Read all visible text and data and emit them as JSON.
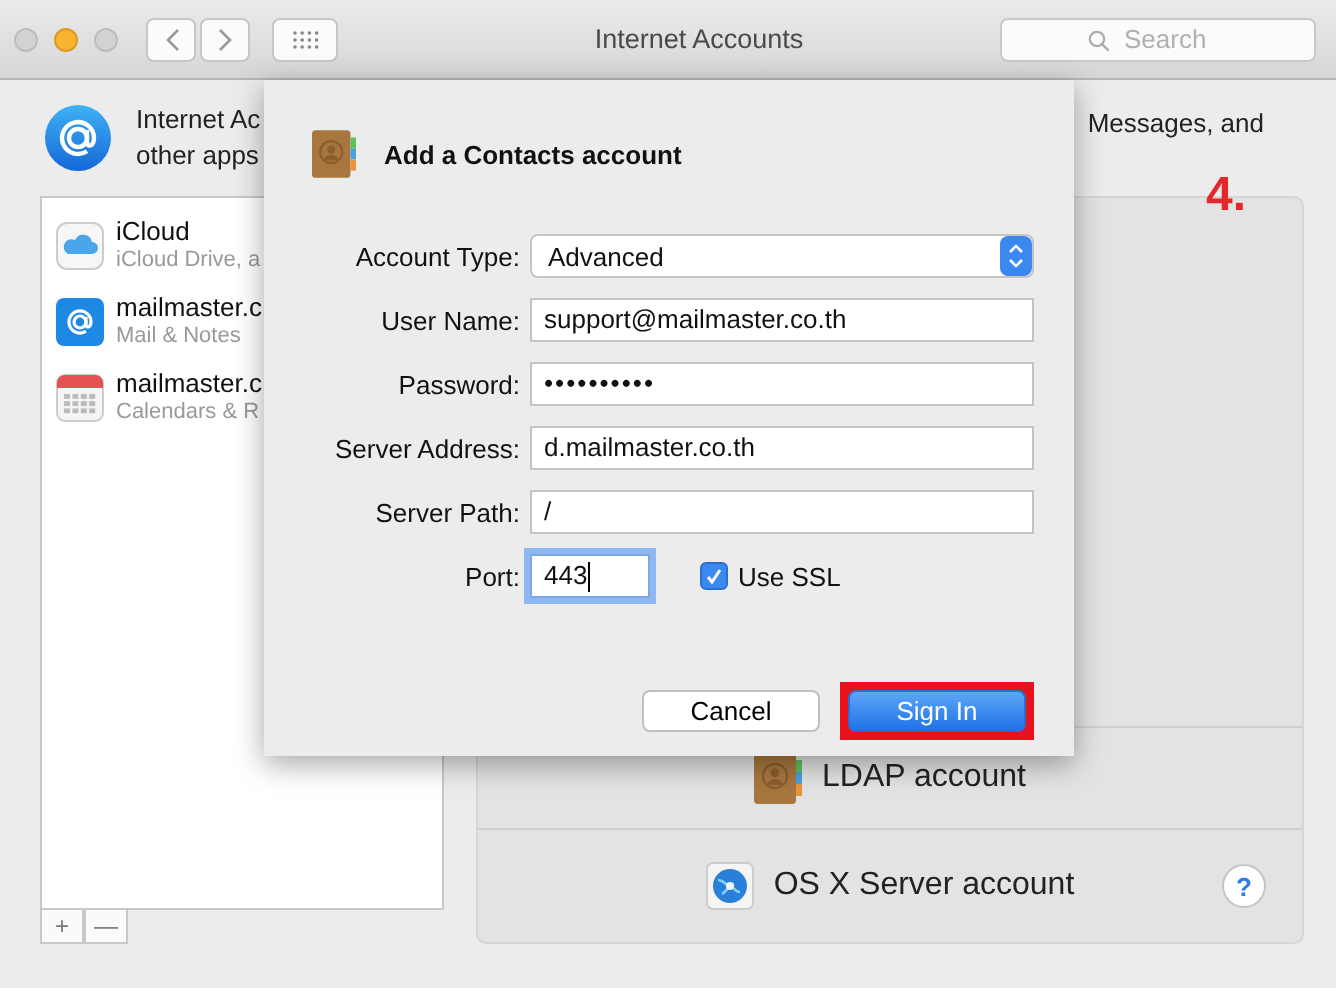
{
  "window": {
    "title": "Internet Accounts",
    "search": {
      "placeholder": "Search"
    }
  },
  "header": {
    "lines_left": [
      "Internet Ac",
      "other apps"
    ],
    "text_right": "Messages, and"
  },
  "accounts": [
    {
      "name": "iCloud",
      "detail": "iCloud Drive, a",
      "kind": "icloud",
      "selected": false
    },
    {
      "name": "mailmaster.c",
      "detail": "Mail & Notes",
      "kind": "mail",
      "selected": false
    },
    {
      "name": "mailmaster.c",
      "detail": "Calendars & R",
      "kind": "calendar",
      "selected": false
    }
  ],
  "list_buttons": [
    "+",
    "—"
  ],
  "providers": [
    {
      "label": "LDAP account",
      "kind": "contacts"
    },
    {
      "label": "OS X Server account",
      "kind": "server"
    }
  ],
  "help": "?",
  "sheet": {
    "title": "Add a Contacts account",
    "fields": [
      {
        "label": "Account Type:",
        "kind": "popup",
        "value": "Advanced"
      },
      {
        "label": "User Name:",
        "kind": "text",
        "value": "support@mailmaster.co.th"
      },
      {
        "label": "Password:",
        "kind": "password",
        "value": "••••••••••"
      },
      {
        "label": "Server Address:",
        "kind": "text",
        "value": "d.mailmaster.co.th"
      },
      {
        "label": "Server Path:",
        "kind": "text",
        "value": "/"
      }
    ],
    "port": {
      "label": "Port:",
      "value": "443",
      "focused": true
    },
    "ssl": {
      "label": "Use SSL",
      "checked": true
    },
    "buttons": [
      {
        "label": "Cancel",
        "kind": "normal",
        "highlighted": false
      },
      {
        "label": "Sign In",
        "kind": "default",
        "highlighted": true
      }
    ]
  },
  "annotation": {
    "text": "4."
  }
}
